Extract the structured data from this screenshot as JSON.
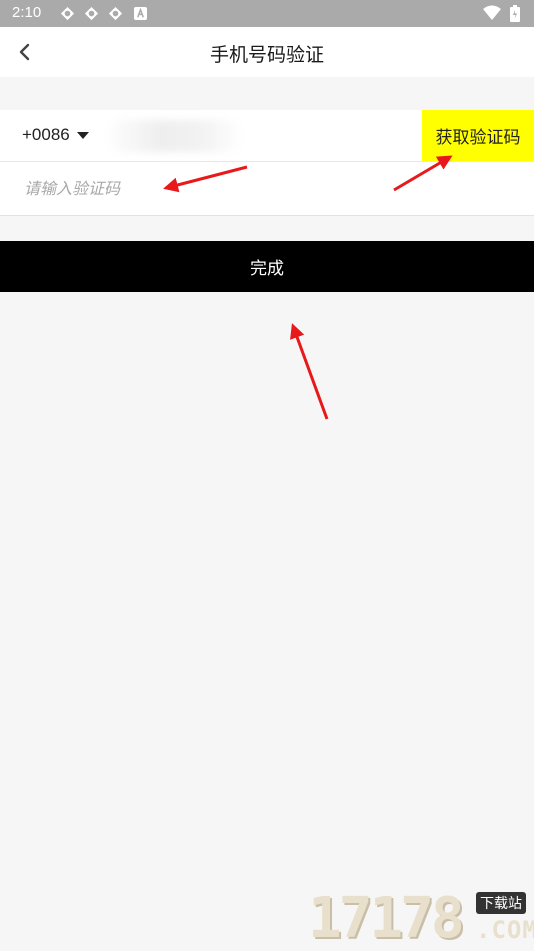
{
  "status_bar": {
    "time": "2:10",
    "icons": [
      "app-notification-icon",
      "app-notification-icon",
      "app-notification-icon",
      "a-badge-icon"
    ],
    "right_icons": [
      "wifi-icon",
      "battery-icon"
    ]
  },
  "header": {
    "back_icon": "chevron-left-icon",
    "title": "手机号码验证"
  },
  "form": {
    "country_code": "+0086",
    "caret_icon": "caret-down-icon",
    "get_code_label": "获取验证码",
    "code_placeholder": "请输入验证码"
  },
  "submit_label": "完成",
  "watermark": {
    "digits": "17178",
    "badge": "下载站",
    "com": ".COM"
  },
  "colors": {
    "get_code_bg": "#ffff00",
    "submit_bg": "#000000",
    "annotation_arrow": "#e8191b",
    "status_bar_bg": "#aaaaaa"
  }
}
